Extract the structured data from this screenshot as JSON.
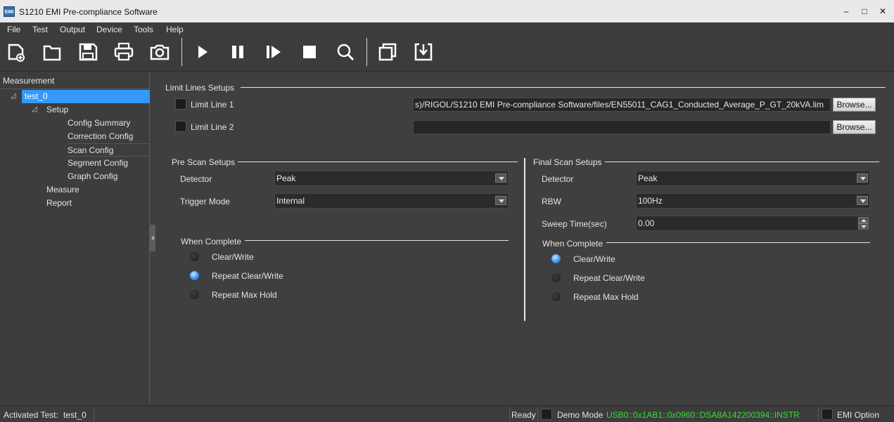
{
  "window": {
    "title": "S1210 EMI Pre-compliance Software",
    "app_icon": "EMI"
  },
  "menu": [
    "File",
    "Test",
    "Output",
    "Device",
    "Tools",
    "Help"
  ],
  "toolbar_icons": [
    "new-file-icon",
    "open-folder-icon",
    "save-icon",
    "print-icon",
    "camera-icon",
    "play-icon",
    "pause-icon",
    "step-icon",
    "stop-icon",
    "search-icon",
    "window-icon",
    "import-icon"
  ],
  "sidebar": {
    "header": "Measurement",
    "items": [
      {
        "label": "test_0"
      },
      {
        "label": "Setup"
      },
      {
        "label": "Config Summary"
      },
      {
        "label": "Correction Config"
      },
      {
        "label": "Scan Config"
      },
      {
        "label": "Segment Config"
      },
      {
        "label": "Graph Config"
      },
      {
        "label": "Measure"
      },
      {
        "label": "Report"
      }
    ]
  },
  "limit_lines": {
    "title": "Limit Lines Setups",
    "line1": {
      "label": "Limit Line 1",
      "path": "s)/RIGOL/S1210 EMI Pre-compliance Software/files/EN55011_CAG1_Conducted_Average_P_GT_20kVA.lim",
      "browse": "Browse..."
    },
    "line2": {
      "label": "Limit Line 2",
      "path": "",
      "browse": "Browse..."
    }
  },
  "pre_scan": {
    "title": "Pre Scan Setups",
    "detector_label": "Detector",
    "detector_value": "Peak",
    "trigger_label": "Trigger Mode",
    "trigger_value": "Internal",
    "when_complete": "When Complete",
    "options": [
      "Clear/Write",
      "Repeat Clear/Write",
      "Repeat Max Hold"
    ],
    "selected": 1
  },
  "final_scan": {
    "title": "Final Scan Setups",
    "detector_label": "Detector",
    "detector_value": "Peak",
    "rbw_label": "RBW",
    "rbw_value": "100Hz",
    "sweep_label": "Sweep Time(sec)",
    "sweep_value": "0.00",
    "when_complete": "When Complete",
    "options": [
      "Clear/Write",
      "Repeat Clear/Write",
      "Repeat Max Hold"
    ],
    "selected": 0
  },
  "status": {
    "activated_label": "Activated Test:",
    "activated_value": "test_0",
    "ready": "Ready",
    "demo_mode": "Demo Mode",
    "instrument": "USB0::0x1AB1::0x0960::DSA8A142200394::INSTR",
    "emi_option": "EMI Option"
  }
}
